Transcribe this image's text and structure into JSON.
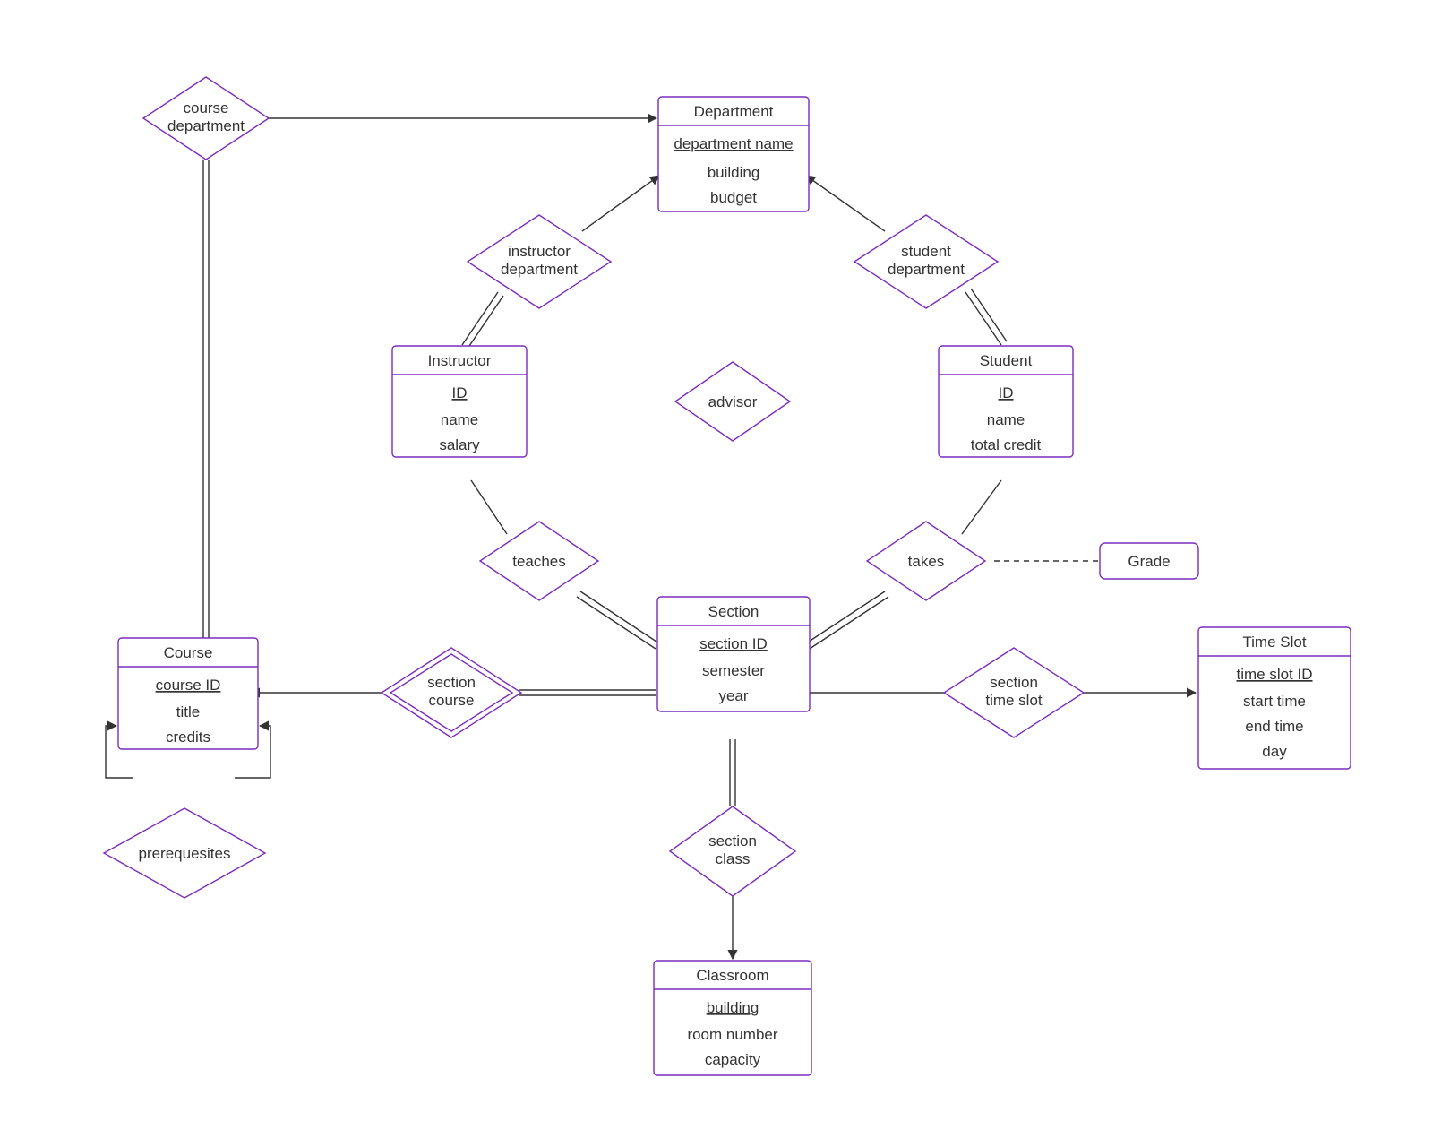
{
  "entities": {
    "department": {
      "title": "Department",
      "pk": "department name",
      "a2": "building",
      "a3": "budget"
    },
    "instructor": {
      "title": "Instructor",
      "pk": "ID",
      "a2": "name",
      "a3": "salary"
    },
    "student": {
      "title": "Student",
      "pk": "ID",
      "a2": "name",
      "a3": "total credit"
    },
    "section": {
      "title": "Section",
      "pk": "section ID",
      "a2": "semester",
      "a3": "year"
    },
    "course": {
      "title": "Course",
      "pk": "course ID",
      "a2": "title",
      "a3": "credits"
    },
    "classroom": {
      "title": "Classroom",
      "pk": "building",
      "a2": "room number",
      "a3": "capacity"
    },
    "timeslot": {
      "title": "Time Slot",
      "pk": "time slot ID",
      "a2": "start time",
      "a3": "end time",
      "a4": "day"
    }
  },
  "relationships": {
    "course_department": {
      "l1": "course",
      "l2": "department"
    },
    "instructor_department": {
      "l1": "instructor",
      "l2": "department"
    },
    "student_department": {
      "l1": "student",
      "l2": "department"
    },
    "advisor": {
      "l1": "advisor"
    },
    "teaches": {
      "l1": "teaches"
    },
    "takes": {
      "l1": "takes"
    },
    "section_course": {
      "l1": "section",
      "l2": "course"
    },
    "section_class": {
      "l1": "section",
      "l2": "class"
    },
    "section_timeslot": {
      "l1": "section",
      "l2": "time slot"
    },
    "prerequisites": {
      "l1": "prerequesites"
    }
  },
  "attributes": {
    "grade": "Grade"
  }
}
